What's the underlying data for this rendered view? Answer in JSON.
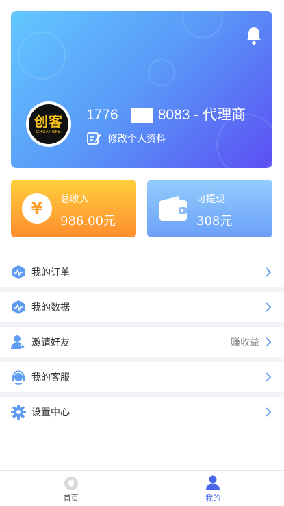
{
  "profile": {
    "phone_prefix": "1776",
    "phone_hidden": "",
    "phone_suffix": "8083 - 代理商",
    "edit_label": "修改个人资料",
    "logo_text": "创客",
    "logo_subtext": "CHUANGKE",
    "bell_icon": "bell-icon"
  },
  "stats": {
    "income": {
      "label": "总收入",
      "value": "986.00元",
      "icon": "yen-icon"
    },
    "withdraw": {
      "label": "可提现",
      "value": "308元",
      "icon": "wallet-icon"
    }
  },
  "menu": [
    {
      "label": "我的订单",
      "extra": "",
      "icon": "order-icon"
    },
    {
      "label": "我的数据",
      "extra": "",
      "icon": "data-icon"
    },
    {
      "label": "邀请好友",
      "extra": "赚收益",
      "icon": "invite-icon"
    },
    {
      "label": "我的客服",
      "extra": "",
      "icon": "customer-service-icon"
    },
    {
      "label": "设置中心",
      "extra": "",
      "icon": "settings-icon"
    }
  ],
  "tabs": [
    {
      "label": "首页",
      "icon": "home-icon",
      "active": false
    },
    {
      "label": "我的",
      "icon": "user-icon",
      "active": true
    }
  ],
  "colors": {
    "accent": "#4a67e9",
    "card_gradient_start": "#62c8ff",
    "card_gradient_end": "#5b4ff2",
    "income_gradient": "#ffb233",
    "withdraw_gradient": "#7eb3f9",
    "menu_icon": "#5e9bf3"
  }
}
